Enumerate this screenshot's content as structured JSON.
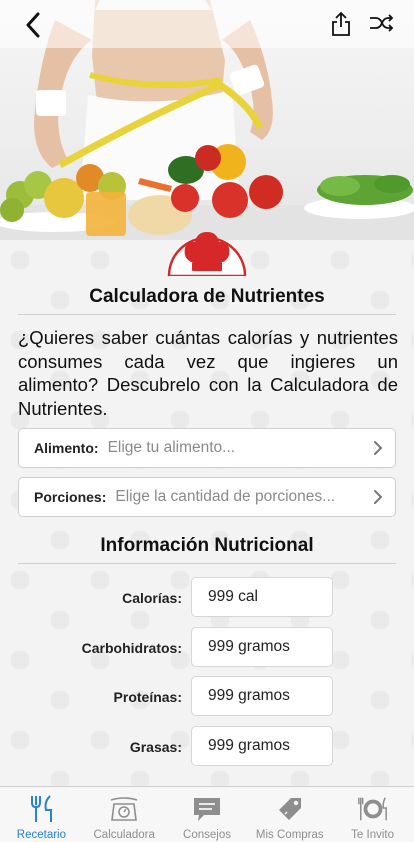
{
  "header": {
    "back_icon": "chevron-left-icon",
    "share_icon": "share-icon",
    "shuffle_icon": "shuffle-icon"
  },
  "page": {
    "title": "Calculadora de Nutrientes",
    "intro": "¿Quieres saber cuántas calorías y nutrientes consumes cada vez que ingieres un alimento? Descubrelo con la Calculadora de Nutrientes.",
    "accent_color": "#d62828"
  },
  "selectors": {
    "food": {
      "label": "Alimento:",
      "placeholder": "Elige tu alimento..."
    },
    "portions": {
      "label": "Porciones:",
      "placeholder": "Elige la cantidad de porciones..."
    }
  },
  "nutrition": {
    "title": "Información Nutricional",
    "rows": [
      {
        "label": "Calorías:",
        "value": "999 cal"
      },
      {
        "label": "Carbohidratos:",
        "value": "999 gramos"
      },
      {
        "label": "Proteínas:",
        "value": "999 gramos"
      },
      {
        "label": "Grasas:",
        "value": "999 gramos"
      }
    ]
  },
  "tabbar": {
    "active_color": "#2a7fd9",
    "items": [
      {
        "label": "Recetario",
        "icon": "fork-knife-icon",
        "active": true
      },
      {
        "label": "Calculadora",
        "icon": "scale-icon",
        "active": false
      },
      {
        "label": "Consejos",
        "icon": "chat-bubble-icon",
        "active": false
      },
      {
        "label": "Mis Compras",
        "icon": "tag-icon",
        "active": false
      },
      {
        "label": "Te Invito",
        "icon": "plate-icon",
        "active": false
      }
    ]
  }
}
